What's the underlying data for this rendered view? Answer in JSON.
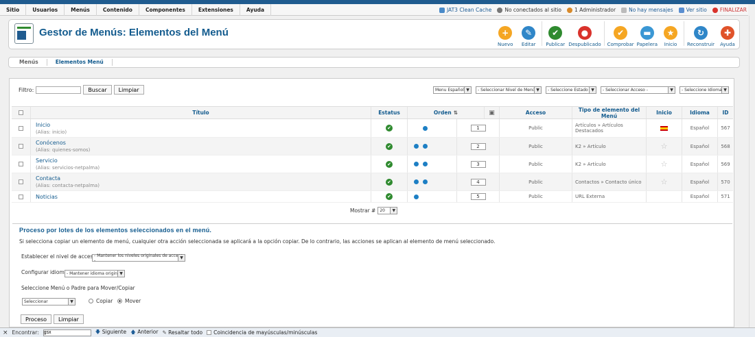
{
  "menubar": {
    "items": [
      "Sitio",
      "Usuarios",
      "Menús",
      "Contenido",
      "Componentes",
      "Extensiones",
      "Ayuda"
    ]
  },
  "status": {
    "items": [
      "JAT3 Clean Cache",
      "No conectados al sitio",
      "1 Administrador",
      "No hay mensajes",
      "Ver sitio",
      "FINALIZAR"
    ]
  },
  "header": {
    "title": "Gestor de Menús: Elementos del Menú"
  },
  "toolbar": {
    "buttons": [
      {
        "label": "Nuevo",
        "color": "#f5a623",
        "glyph": "+"
      },
      {
        "label": "Editar",
        "color": "#2f86c8",
        "glyph": "✎"
      },
      {
        "label": "Publicar",
        "color": "#2f8a2f",
        "glyph": "✔"
      },
      {
        "label": "Despublicado",
        "color": "#d9322b",
        "glyph": "●"
      },
      {
        "label": "Comprobar",
        "color": "#f5a623",
        "glyph": "✔"
      },
      {
        "label": "Papelera",
        "color": "#3a97d4",
        "glyph": "▬"
      },
      {
        "label": "Inicio",
        "color": "#f5a623",
        "glyph": "★"
      },
      {
        "label": "Reconstruir",
        "color": "#2f86c8",
        "glyph": "↻"
      },
      {
        "label": "Ayuda",
        "color": "#e0532a",
        "glyph": "✚"
      }
    ]
  },
  "subnav": {
    "items": [
      "Menús",
      "Elementos Menú"
    ]
  },
  "filter": {
    "label": "Filtro:",
    "value": "",
    "search": "Buscar",
    "clear": "Limpiar"
  },
  "selects": [
    "Menu Español",
    "- Seleccionar Nivel de Menú -",
    "- Seleccione Estado -",
    "- Seleccionar Acceso -",
    "- Seleccione Idioma -"
  ],
  "columns": {
    "title": "Título",
    "status": "Estatus",
    "order": "Orden",
    "access": "Acceso",
    "type": "Tipo de elemento del Menú",
    "home": "Inicio",
    "lang": "Idioma",
    "id": "ID"
  },
  "rows": [
    {
      "name": "Inicio",
      "alias": "inicio",
      "order": "1",
      "access": "Public",
      "type": "Artículos » Artículos Destacados",
      "lang": "Español",
      "id": "567",
      "home": "flag",
      "up": false,
      "down": true
    },
    {
      "name": "Conócenos",
      "alias": "quienes-somos",
      "order": "2",
      "access": "Public",
      "type": "K2 » Artículo",
      "lang": "Español",
      "id": "568",
      "home": "star",
      "up": true,
      "down": true
    },
    {
      "name": "Servicio",
      "alias": "servicios-netpalma",
      "order": "3",
      "access": "Public",
      "type": "K2 » Artículo",
      "lang": "Español",
      "id": "569",
      "home": "star",
      "up": true,
      "down": true
    },
    {
      "name": "Contacta",
      "alias": "contacta-netpalma",
      "order": "4",
      "access": "Public",
      "type": "Contactos » Contacto único",
      "lang": "Español",
      "id": "570",
      "home": "star",
      "up": true,
      "down": true
    },
    {
      "name": "Noticias",
      "alias": "",
      "order": "5",
      "access": "Public",
      "type": "URL Externa",
      "lang": "Español",
      "id": "571",
      "home": "",
      "up": true,
      "down": false
    }
  ],
  "alias_prefix": "(Alias: ",
  "alias_suffix": ")",
  "mostrar": {
    "label": "Mostrar #",
    "value": "20"
  },
  "batch": {
    "title": "Proceso por lotes de los elementos seleccionados en el menú.",
    "desc": "Si selecciona copiar un elemento de menú, cualquier otra acción seleccionada se aplicará a la opción copiar. De lo contrario, las acciones se aplican al elemento de menú seleccionado.",
    "access_label": "Establecer el nivel de acceso",
    "access_value": "- Mantener los niveles originales de acceso -",
    "lang_label": "Configurar idioma",
    "lang_value": "- Mantener idioma original -",
    "move_label": "Seleccione Menú o Padre para Mover/Copiar",
    "move_value": "Seleccionar",
    "copy": "Copiar",
    "move": "Mover",
    "process": "Proceso",
    "clear": "Limpiar"
  },
  "findbar": {
    "label": "Encontrar:",
    "value": "gsx",
    "next": "Siguiente",
    "prev": "Anterior",
    "highlight": "Resaltar todo",
    "match": "Coincidencia de mayúsculas/minúsculas"
  }
}
